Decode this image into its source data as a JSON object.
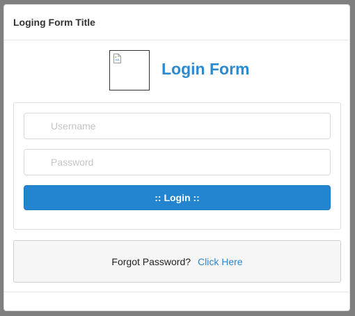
{
  "modal": {
    "title": "Loging Form Title"
  },
  "brand": {
    "logo_icon": "broken-image-icon",
    "title": "Login Form",
    "accent_color": "#2c8ad0"
  },
  "form": {
    "username": {
      "value": "",
      "placeholder": "Username"
    },
    "password": {
      "value": "",
      "placeholder": "Password"
    },
    "login_label": ":: Login ::",
    "button_color": "#2385d0"
  },
  "forgot": {
    "text": "Forgot Password?",
    "link_label": "Click Here"
  }
}
